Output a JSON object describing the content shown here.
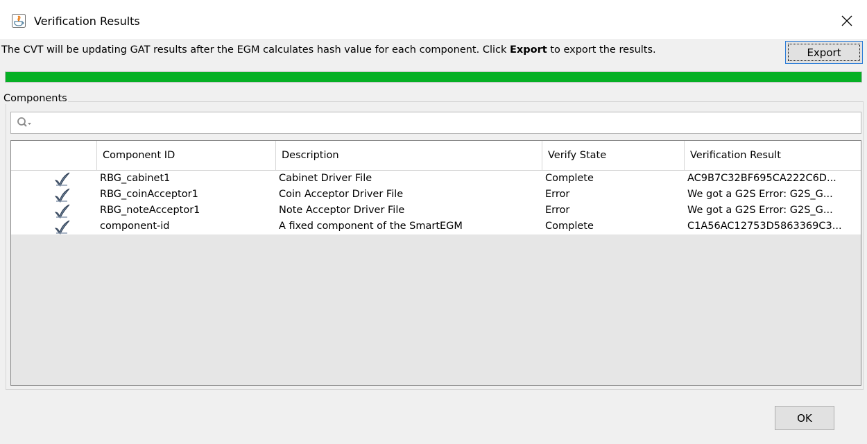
{
  "window": {
    "title": "Verification Results",
    "close_glyph": "✕"
  },
  "message": {
    "before": "The CVT will be updating GAT results after the EGM calculates hash value for each component. Click ",
    "bold": "Export",
    "after": " to export the results."
  },
  "buttons": {
    "export_label": "Export",
    "ok_label": "OK"
  },
  "progress": {
    "percent": 100,
    "color": "#06b025"
  },
  "components": {
    "group_label": "Components",
    "search_icon": "search-icon",
    "columns": [
      "",
      "Component ID",
      "Description",
      "Verify State",
      "Verification Result"
    ],
    "rows": [
      {
        "icon": "check-icon",
        "id": "RBG_cabinet1",
        "description": "Cabinet Driver File",
        "state": "Complete",
        "result": "AC9B7C32BF695CA222C6D..."
      },
      {
        "icon": "check-icon",
        "id": "RBG_coinAcceptor1",
        "description": "Coin Acceptor Driver File",
        "state": "Error",
        "result": "We got a G2S Error: G2S_G..."
      },
      {
        "icon": "check-icon",
        "id": "RBG_noteAcceptor1",
        "description": "Note Acceptor Driver File",
        "state": "Error",
        "result": "We got a G2S Error: G2S_G..."
      },
      {
        "icon": "check-icon",
        "id": "component-id",
        "description": "A fixed component of the SmartEGM",
        "state": "Complete",
        "result": "C1A56AC12753D5863369C3..."
      }
    ]
  }
}
